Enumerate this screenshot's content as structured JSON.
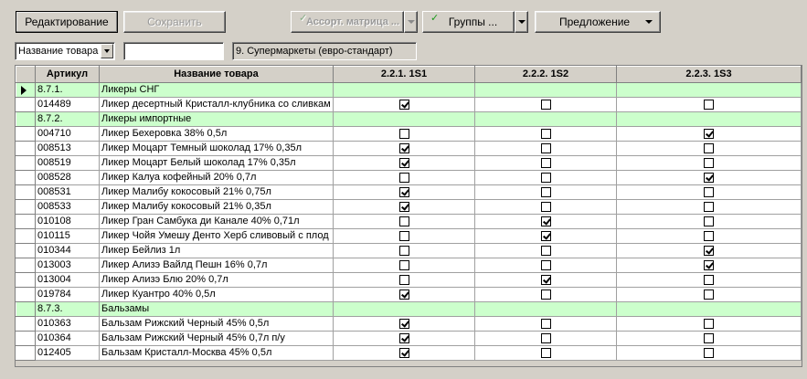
{
  "toolbar": {
    "edit_label": "Редактирование",
    "save_label": "Сохранить",
    "assort_label": "Ассорт. матрица ...",
    "groups_label": "Группы ...",
    "offer_label": "Предложение"
  },
  "filter": {
    "field_select": "Название товара",
    "search_value": "",
    "store_format": "9. Супермаркеты (евро-стандарт)"
  },
  "grid": {
    "columns": [
      "Артикул",
      "Название товара",
      "2.2.1. 1S1",
      "2.2.2. 1S2",
      "2.2.3. 1S3"
    ],
    "rows": [
      {
        "code": "8.7.1.",
        "name": "Ликеры СНГ",
        "group": true,
        "checks": []
      },
      {
        "code": "014489",
        "name": "Ликер десертный Кристалл-клубника со сливкам",
        "group": false,
        "checks": [
          true,
          false,
          false
        ]
      },
      {
        "code": "8.7.2.",
        "name": "Ликеры импортные",
        "group": true,
        "checks": []
      },
      {
        "code": "004710",
        "name": "Ликер Бехеровка 38% 0,5л",
        "group": false,
        "checks": [
          false,
          false,
          true
        ]
      },
      {
        "code": "008513",
        "name": "Ликер Моцарт Темный шоколад 17% 0,35л",
        "group": false,
        "checks": [
          true,
          false,
          false
        ]
      },
      {
        "code": "008519",
        "name": "Ликер Моцарт Белый шоколад 17% 0,35л",
        "group": false,
        "checks": [
          true,
          false,
          false
        ]
      },
      {
        "code": "008528",
        "name": "Ликер Калуа кофейный 20% 0,7л",
        "group": false,
        "checks": [
          false,
          false,
          true
        ]
      },
      {
        "code": "008531",
        "name": "Ликер Малибу кокосовый 21% 0,75л",
        "group": false,
        "checks": [
          true,
          false,
          false
        ]
      },
      {
        "code": "008533",
        "name": "Ликер Малибу кокосовый 21% 0,35л",
        "group": false,
        "checks": [
          true,
          false,
          false
        ]
      },
      {
        "code": "010108",
        "name": "Ликер Гран Самбука ди Канале 40% 0,71л",
        "group": false,
        "checks": [
          false,
          true,
          false
        ]
      },
      {
        "code": "010115",
        "name": "Ликер Чойя Умешу Денто Херб сливовый с плод",
        "group": false,
        "checks": [
          false,
          true,
          false
        ]
      },
      {
        "code": "010344",
        "name": "Ликер Бейлиз 1л",
        "group": false,
        "checks": [
          false,
          false,
          true
        ]
      },
      {
        "code": "013003",
        "name": "Ликер Ализэ Вайлд Пешн 16% 0,7л",
        "group": false,
        "checks": [
          false,
          false,
          true
        ]
      },
      {
        "code": "013004",
        "name": "Ликер Ализэ Блю 20% 0,7л",
        "group": false,
        "checks": [
          false,
          true,
          false
        ]
      },
      {
        "code": "019784",
        "name": "Ликер Куантро 40% 0,5л",
        "group": false,
        "checks": [
          true,
          false,
          false
        ]
      },
      {
        "code": "8.7.3.",
        "name": "Бальзамы",
        "group": true,
        "checks": []
      },
      {
        "code": "010363",
        "name": "Бальзам Рижский Черный 45% 0,5л",
        "group": false,
        "checks": [
          true,
          false,
          false
        ]
      },
      {
        "code": "010364",
        "name": "Бальзам Рижский Черный 45% 0,7л п/у",
        "group": false,
        "checks": [
          true,
          false,
          false
        ]
      },
      {
        "code": "012405",
        "name": "Бальзам Кристалл-Москва 45% 0,5л",
        "group": false,
        "checks": [
          true,
          false,
          false
        ]
      }
    ]
  },
  "colors": {
    "group_row": "#ccffcc",
    "background": "#d4d0c8"
  }
}
